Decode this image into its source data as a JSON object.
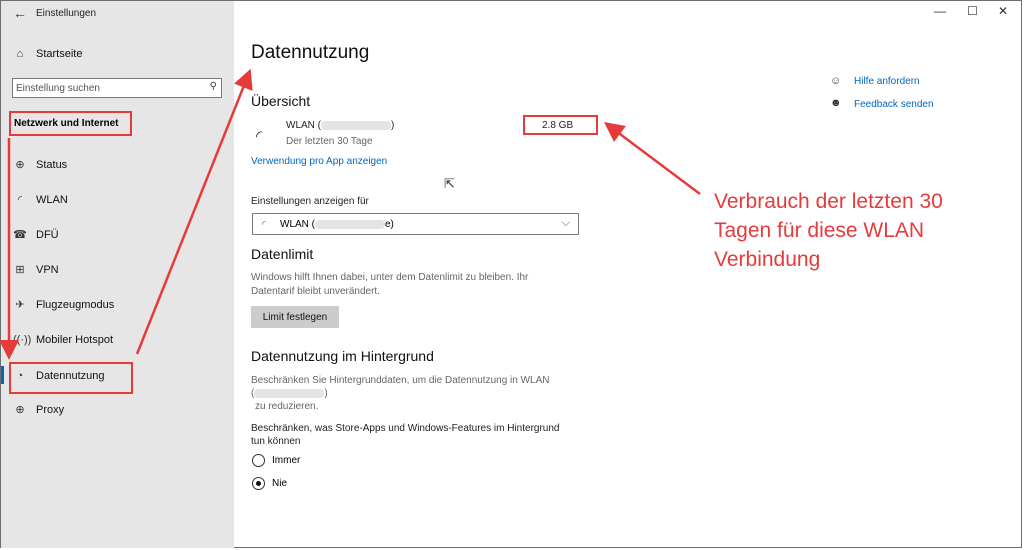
{
  "window": {
    "title": "Einstellungen",
    "back_icon": "back-arrow-icon",
    "controls": {
      "minimize": "—",
      "maximize": "☐",
      "close": "✕"
    }
  },
  "sidebar": {
    "home_label": "Startseite",
    "search_placeholder": "Einstellung suchen",
    "section_title": "Netzwerk und Internet",
    "items": [
      {
        "label": "Status",
        "icon": "globe-status-icon"
      },
      {
        "label": "WLAN",
        "icon": "wifi-icon"
      },
      {
        "label": "DFÜ",
        "icon": "dialup-icon"
      },
      {
        "label": "VPN",
        "icon": "vpn-icon"
      },
      {
        "label": "Flugzeugmodus",
        "icon": "airplane-icon"
      },
      {
        "label": "Mobiler Hotspot",
        "icon": "hotspot-icon"
      },
      {
        "label": "Datennutzung",
        "icon": "data-usage-icon",
        "active": true
      },
      {
        "label": "Proxy",
        "icon": "globe-icon"
      }
    ]
  },
  "main": {
    "title": "Datennutzung",
    "overview": {
      "heading": "Übersicht",
      "network_name_prefix": "WLAN (",
      "network_name_suffix": ")",
      "period": "Der letzten 30 Tage",
      "usage": "2.8 GB",
      "per_app_link": "Verwendung pro App anzeigen"
    },
    "show_settings_for": {
      "label": "Einstellungen anzeigen für",
      "selected_prefix": "WLAN (",
      "selected_suffix": "e)"
    },
    "data_limit": {
      "heading": "Datenlimit",
      "description_line1": "Windows hilft Ihnen dabei, unter dem Datenlimit zu bleiben. Ihr",
      "description_line2": "Datentarif bleibt unverändert.",
      "button": "Limit festlegen"
    },
    "background": {
      "heading": "Datennutzung im Hintergrund",
      "description_line1": "Beschränken Sie Hintergrunddaten, um die Datennutzung in WLAN",
      "description_line2_prefix": "(",
      "description_line2_suffix": ")",
      "description_line3": "zu reduzieren.",
      "question_line1": "Beschränken, was Store-Apps und Windows-Features im Hintergrund",
      "question_line2": "tun können",
      "options": [
        {
          "label": "Immer",
          "checked": false
        },
        {
          "label": "Nie",
          "checked": true
        }
      ]
    },
    "help": {
      "get_help": "Hilfe anfordern",
      "feedback": "Feedback senden"
    }
  },
  "annotation": {
    "line1": "Verbrauch der letzten 30",
    "line2": "Tagen für diese WLAN",
    "line3": "Verbindung",
    "color": "#e63b3b"
  }
}
